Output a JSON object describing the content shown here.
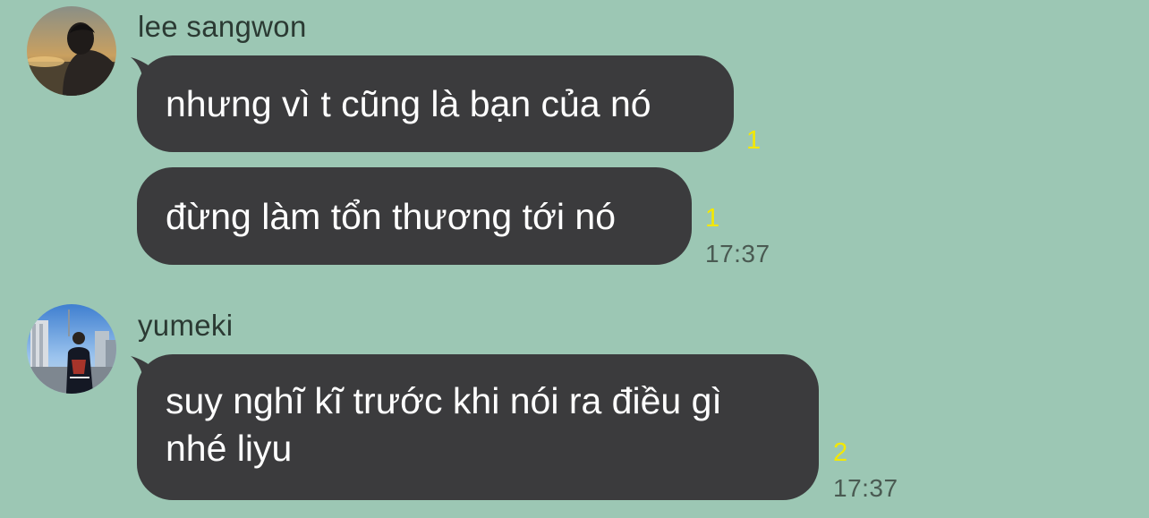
{
  "colors": {
    "background": "#9cc7b4",
    "bubble": "#3b3b3d",
    "bubble_text": "#ffffff",
    "unread": "#f4e800",
    "time": "#4a5a52",
    "sender_name": "#2b3a33"
  },
  "messages": [
    {
      "sender": "lee sangwon",
      "avatar_icon": "profile-photo-icon",
      "bubbles": [
        {
          "lines": [
            "nhưng vì t cũng là bạn của nó"
          ],
          "unread": "1",
          "time": ""
        },
        {
          "lines": [
            "đừng làm tổn thương tới nó"
          ],
          "unread": "1",
          "time": "17:37"
        }
      ]
    },
    {
      "sender": "yumeki",
      "avatar_icon": "profile-photo-icon",
      "bubbles": [
        {
          "lines": [
            "suy nghĩ kĩ trước khi nói ra điều gì",
            "nhé liyu"
          ],
          "unread": "2",
          "time": "17:37"
        }
      ]
    }
  ]
}
